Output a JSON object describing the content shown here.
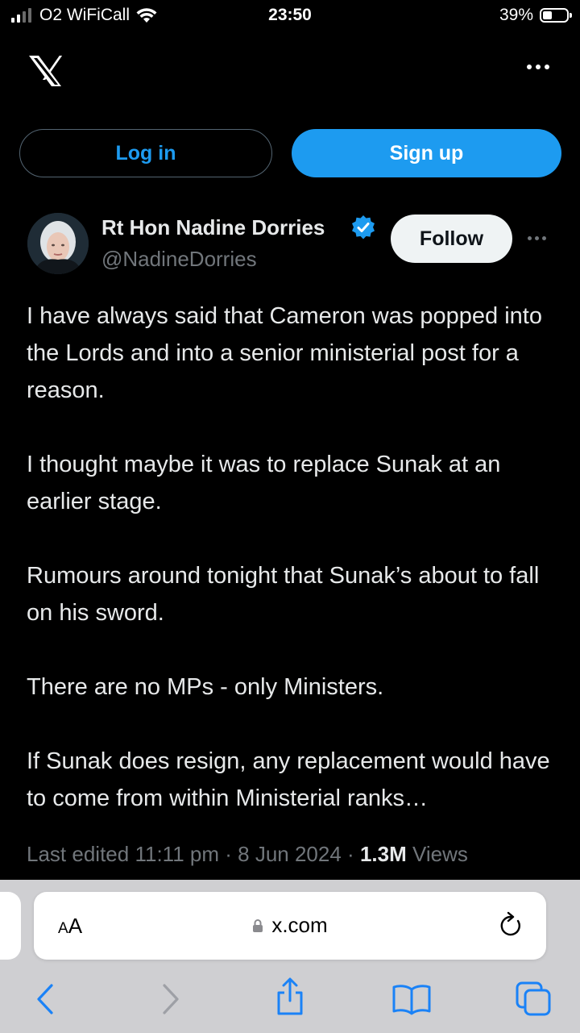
{
  "status_bar": {
    "carrier": "O2 WiFiCall",
    "time": "23:50",
    "battery_percent": "39%",
    "battery_level": 0.39
  },
  "topbar": {
    "logo": "x-logo-icon",
    "more": "more-icon"
  },
  "auth": {
    "login_label": "Log in",
    "signup_label": "Sign up"
  },
  "tweet": {
    "display_name": "Rt Hon Nadine Dorries",
    "verified": true,
    "handle": "@NadineDorries",
    "follow_label": "Follow",
    "paragraphs": [
      "I have always said that Cameron was popped into the Lords and into a senior ministerial post for a reason.",
      "I thought maybe it was to replace Sunak at an earlier stage.",
      "Rumours around tonight that Sunak’s about to fall on his sword.",
      "There are no MPs - only Ministers.",
      "If Sunak does resign, any replacement would have to come from within Ministerial ranks…"
    ],
    "meta": {
      "edited_prefix": "Last edited",
      "time": "11:11 pm",
      "sep1": "·",
      "date": "8 Jun 2024",
      "sep2": "·",
      "views_count": "1.3M",
      "views_label": "Views"
    }
  },
  "safari": {
    "aa_large": "A",
    "aa_small": "A",
    "url": "x.com",
    "toolbar_icons": [
      "back-icon",
      "forward-icon",
      "share-icon",
      "bookmarks-icon",
      "tabs-icon"
    ]
  },
  "colors": {
    "accent": "#1d9bf0",
    "background": "#000000",
    "text_primary": "#e7e9ea",
    "text_secondary": "#71767b",
    "safari_bar": "#cfcfd2",
    "safari_tint": "#1a82f7"
  }
}
